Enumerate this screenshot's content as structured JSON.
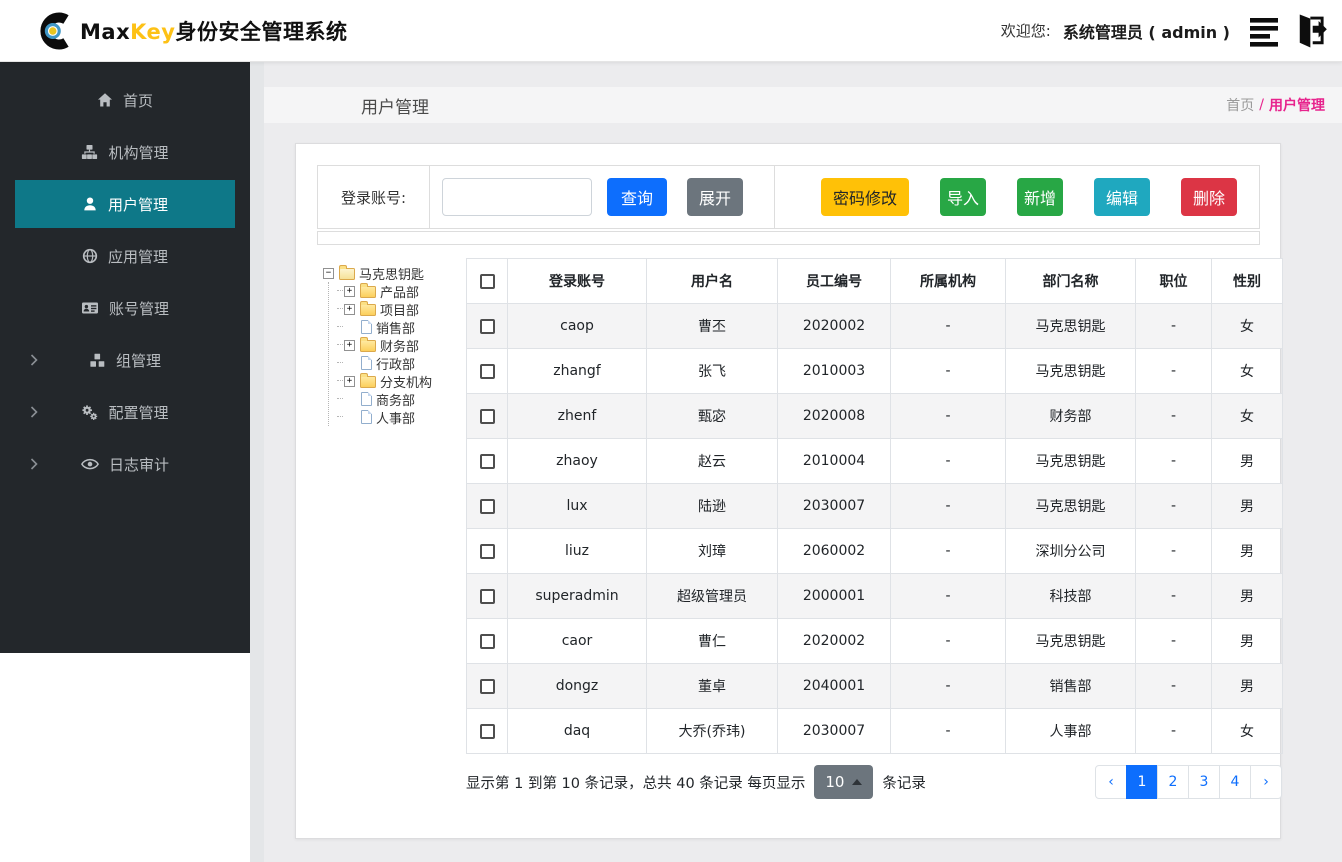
{
  "navbar": {
    "brand_max": "Max",
    "brand_key": "Key",
    "brand_suffix": "身份安全管理系统",
    "welcome_label": "欢迎您:",
    "user_label": "系统管理员 ( admin )"
  },
  "sidebar": {
    "items": [
      {
        "label": "首页",
        "icon": "home-icon",
        "active": false,
        "expandable": false
      },
      {
        "label": "机构管理",
        "icon": "sitemap-icon",
        "active": false,
        "expandable": false
      },
      {
        "label": "用户管理",
        "icon": "user-icon",
        "active": true,
        "expandable": false
      },
      {
        "label": "应用管理",
        "icon": "globe-icon",
        "active": false,
        "expandable": false
      },
      {
        "label": "账号管理",
        "icon": "id-card-icon",
        "active": false,
        "expandable": false
      },
      {
        "label": "组管理",
        "icon": "cubes-icon",
        "active": false,
        "expandable": true
      },
      {
        "label": "配置管理",
        "icon": "gears-icon",
        "active": false,
        "expandable": true
      },
      {
        "label": "日志审计",
        "icon": "eye-icon",
        "active": false,
        "expandable": true
      }
    ]
  },
  "page_header": {
    "title": "用户管理",
    "breadcrumb_home": "首页",
    "breadcrumb_sep": "/",
    "breadcrumb_current": "用户管理"
  },
  "toolbar": {
    "search_label": "登录账号:",
    "search_value": "",
    "query_label": "查询",
    "expand_label": "展开",
    "pwd_label": "密码修改",
    "import_label": "导入",
    "add_label": "新增",
    "edit_label": "编辑",
    "delete_label": "删除"
  },
  "tree": {
    "nodes": [
      {
        "label": "马克思钥匙",
        "icon": "folder-open",
        "expander": "minus",
        "level": 0
      },
      {
        "label": "产品部",
        "icon": "folder",
        "expander": "plus",
        "level": 1
      },
      {
        "label": "项目部",
        "icon": "folder",
        "expander": "plus",
        "level": 1
      },
      {
        "label": "销售部",
        "icon": "file",
        "expander": "none",
        "level": 1
      },
      {
        "label": "财务部",
        "icon": "folder",
        "expander": "plus",
        "level": 1
      },
      {
        "label": "行政部",
        "icon": "file",
        "expander": "none",
        "level": 1
      },
      {
        "label": "分支机构",
        "icon": "folder",
        "expander": "plus",
        "level": 1
      },
      {
        "label": "商务部",
        "icon": "file",
        "expander": "none",
        "level": 1
      },
      {
        "label": "人事部",
        "icon": "file",
        "expander": "none",
        "level": 1
      }
    ],
    "expander_minus": "−",
    "expander_plus": "+"
  },
  "table": {
    "columns": [
      "登录账号",
      "用户名",
      "员工编号",
      "所属机构",
      "部门名称",
      "职位",
      "性别"
    ],
    "rows": [
      [
        "caop",
        "曹丕",
        "2020002",
        "-",
        "马克思钥匙",
        "-",
        "女"
      ],
      [
        "zhangf",
        "张飞",
        "2010003",
        "-",
        "马克思钥匙",
        "-",
        "女"
      ],
      [
        "zhenf",
        "甄宓",
        "2020008",
        "-",
        "财务部",
        "-",
        "女"
      ],
      [
        "zhaoy",
        "赵云",
        "2010004",
        "-",
        "马克思钥匙",
        "-",
        "男"
      ],
      [
        "lux",
        "陆逊",
        "2030007",
        "-",
        "马克思钥匙",
        "-",
        "男"
      ],
      [
        "liuz",
        "刘璋",
        "2060002",
        "-",
        "深圳分公司",
        "-",
        "男"
      ],
      [
        "superadmin",
        "超级管理员",
        "2000001",
        "-",
        "科技部",
        "-",
        "男"
      ],
      [
        "caor",
        "曹仁",
        "2020002",
        "-",
        "马克思钥匙",
        "-",
        "男"
      ],
      [
        "dongz",
        "董卓",
        "2040001",
        "-",
        "销售部",
        "-",
        "男"
      ],
      [
        "daq",
        "大乔(乔玮)",
        "2030007",
        "-",
        "人事部",
        "-",
        "女"
      ]
    ]
  },
  "pagination": {
    "info_prefix": "显示第 1 到第 10 条记录，总共 40 条记录 每页显示",
    "page_size": "10",
    "info_suffix": "条记录",
    "prev": "‹",
    "next": "›",
    "pages": [
      "1",
      "2",
      "3",
      "4"
    ],
    "active_page": "1"
  },
  "colors": {
    "accent_teal": "#0e7888",
    "primary_blue": "#0d6efd",
    "warning_yellow": "#ffc107",
    "success_green": "#28a745",
    "info_teal": "#1fa8bf",
    "danger_red": "#dc3545",
    "secondary_gray": "#6c757d",
    "breadcrumb_pink": "#e7238d",
    "brand_gold": "#fdc116",
    "sidebar_dark": "#23272b"
  }
}
